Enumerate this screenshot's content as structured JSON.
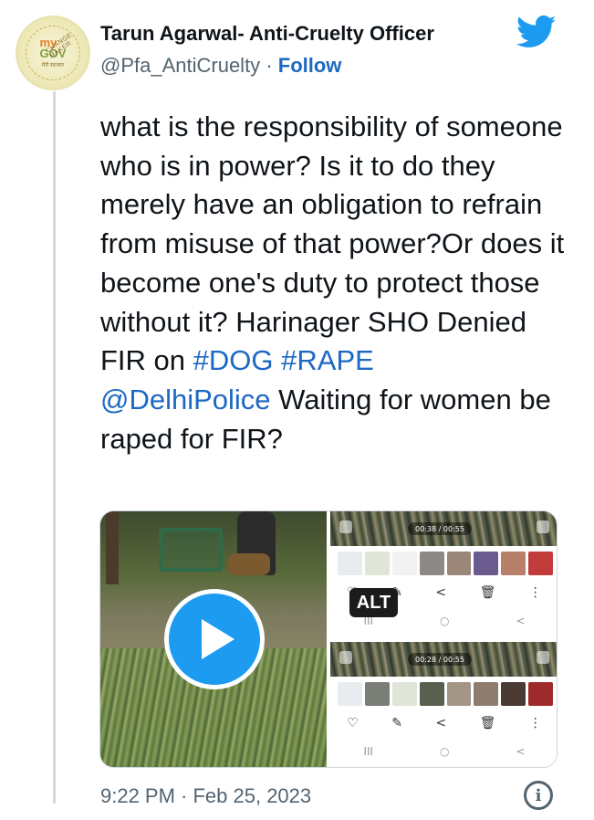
{
  "author": {
    "name": "Tarun Agarwal- Anti-Cruelty Officer",
    "handle": "@Pfa_AntiCruelty",
    "separator": "·",
    "follow_label": "Follow",
    "avatar": {
      "arc_text": "CHANGE MAKER",
      "logo_my": "my",
      "logo_gov": "GOV",
      "tiny_text": "मेरी सरकार"
    }
  },
  "platform_icon": "twitter-bird-icon",
  "tweet": {
    "text_parts": [
      {
        "type": "text",
        "value": "what is the responsibility of someone who is in power? Is it to do they merely have an obligation to refrain from misuse of that power?Or does it become one's duty to protect those without it? Harinager SHO Denied FIR on "
      },
      {
        "type": "hashtag",
        "value": "#DOG"
      },
      {
        "type": "text",
        "value": " "
      },
      {
        "type": "hashtag",
        "value": "#RAPE"
      },
      {
        "type": "text",
        "value": " "
      },
      {
        "type": "mention",
        "value": "@DelhiPolice"
      },
      {
        "type": "text",
        "value": " Waiting for women be raped for FIR?"
      }
    ]
  },
  "media": {
    "video": {
      "play_icon": "play-icon"
    },
    "screenshots": [
      {
        "time": "00:38 / 00:55",
        "toolbar": [
          "♡",
          "✎",
          "<",
          "🗑",
          "⋮"
        ],
        "navbar": [
          "III",
          "○",
          "<"
        ]
      },
      {
        "time": "00:28 / 00:55",
        "toolbar": [
          "♡",
          "✎",
          "<",
          "🗑",
          "⋮"
        ],
        "navbar": [
          "III",
          "○",
          "<"
        ]
      }
    ],
    "alt_badge": "ALT"
  },
  "footer": {
    "timestamp": "9:22 PM · Feb 25, 2023",
    "info_icon": "info-icon",
    "info_glyph": "i"
  },
  "colors": {
    "link": "#1d68c2",
    "twitter_blue": "#1d9bf0",
    "muted": "#536471"
  }
}
